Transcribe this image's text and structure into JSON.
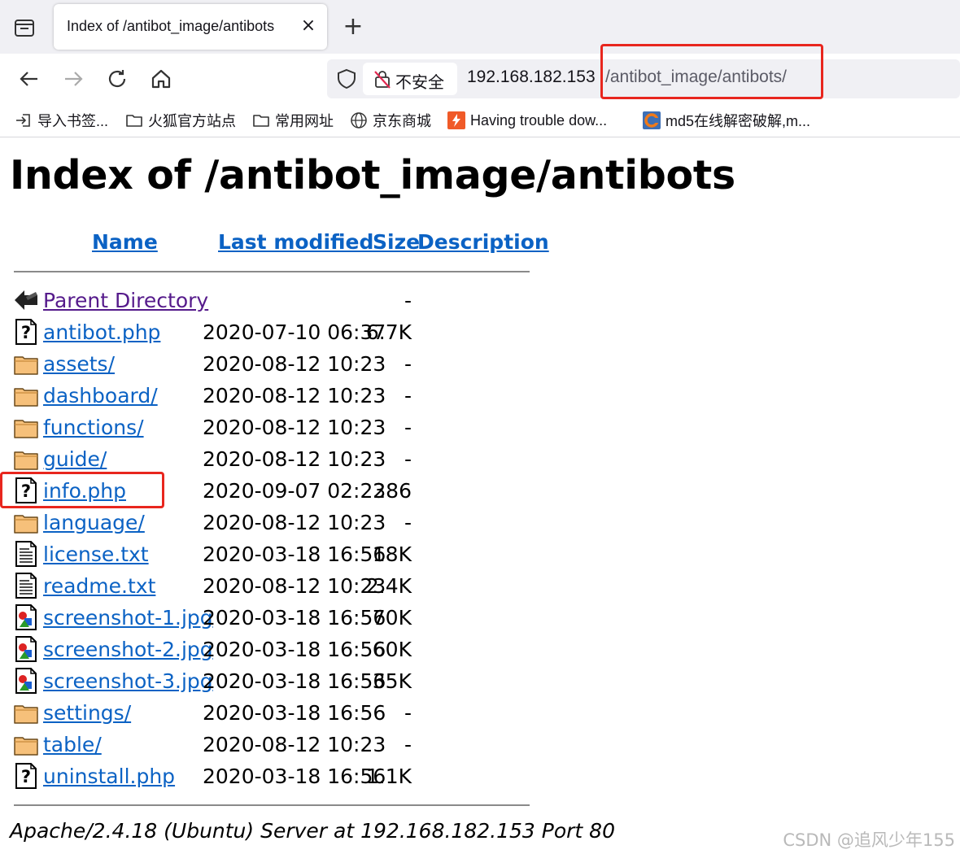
{
  "browser": {
    "tab_title": "Index of /antibot_image/antibots",
    "tab_close": "×",
    "new_tab": "+",
    "insecure_label": "不安全",
    "url_host": "192.168.182.153",
    "url_path": "/antibot_image/antibots/"
  },
  "bookmarks": [
    {
      "label": "导入书签...",
      "icon": "import-icon"
    },
    {
      "label": "火狐官方站点",
      "icon": "folder-icon"
    },
    {
      "label": "常用网址",
      "icon": "folder-icon"
    },
    {
      "label": "京东商城",
      "icon": "globe-icon"
    },
    {
      "label": "Having trouble dow...",
      "icon": "bolt-icon"
    },
    {
      "label": "md5在线解密破解,m...",
      "icon": "site-icon"
    }
  ],
  "page": {
    "title": "Index of /antibot_image/antibots",
    "columns": {
      "name": "Name",
      "modified": "Last modified",
      "size": "Size",
      "description": "Description"
    },
    "rows": [
      {
        "icon": "back-icon",
        "name": "Parent Directory",
        "date": "",
        "size": "-",
        "visited": true
      },
      {
        "icon": "unknown-file-icon",
        "name": "antibot.php",
        "date": "2020-07-10 06:37",
        "size": "6.7K"
      },
      {
        "icon": "folder-icon",
        "name": "assets/",
        "date": "2020-08-12 10:23",
        "size": "-"
      },
      {
        "icon": "folder-icon",
        "name": "dashboard/",
        "date": "2020-08-12 10:23",
        "size": "-"
      },
      {
        "icon": "folder-icon",
        "name": "functions/",
        "date": "2020-08-12 10:23",
        "size": "-"
      },
      {
        "icon": "folder-icon",
        "name": "guide/",
        "date": "2020-08-12 10:23",
        "size": "-"
      },
      {
        "icon": "unknown-file-icon",
        "name": "info.php",
        "date": "2020-09-07 02:23",
        "size": "286"
      },
      {
        "icon": "folder-icon",
        "name": "language/",
        "date": "2020-08-12 10:23",
        "size": "-"
      },
      {
        "icon": "text-file-icon",
        "name": "license.txt",
        "date": "2020-03-18 16:56",
        "size": "18K"
      },
      {
        "icon": "text-file-icon",
        "name": "readme.txt",
        "date": "2020-08-12 10:23",
        "size": "2.4K"
      },
      {
        "icon": "image-file-icon",
        "name": "screenshot-1.jpg",
        "date": "2020-03-18 16:56",
        "size": "70K"
      },
      {
        "icon": "image-file-icon",
        "name": "screenshot-2.jpg",
        "date": "2020-03-18 16:56",
        "size": "60K"
      },
      {
        "icon": "image-file-icon",
        "name": "screenshot-3.jpg",
        "date": "2020-03-18 16:56",
        "size": "35K"
      },
      {
        "icon": "folder-icon",
        "name": "settings/",
        "date": "2020-03-18 16:56",
        "size": "-"
      },
      {
        "icon": "folder-icon",
        "name": "table/",
        "date": "2020-08-12 10:23",
        "size": "-"
      },
      {
        "icon": "unknown-file-icon",
        "name": "uninstall.php",
        "date": "2020-03-18 16:56",
        "size": "1.1K"
      }
    ],
    "address": "Apache/2.4.18 (Ubuntu) Server at 192.168.182.153 Port 80",
    "watermark": "CSDN @追风少年155"
  },
  "colors": {
    "link": "#0b62c4",
    "visited": "#551a8b",
    "highlight": "#e8261e",
    "chrome": "#f0f0f4"
  }
}
